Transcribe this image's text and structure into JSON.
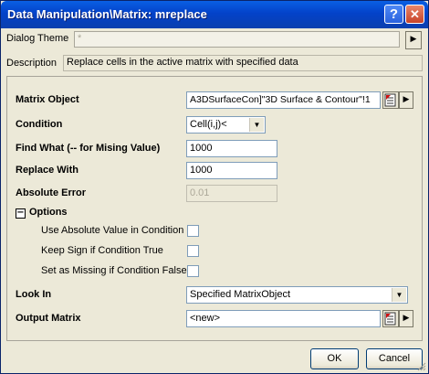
{
  "title": "Data Manipulation\\Matrix: mreplace",
  "titlebar_buttons": {
    "help": "?",
    "close": "✕"
  },
  "theme": {
    "label": "Dialog Theme",
    "value": "*",
    "arrow": "▶"
  },
  "description": {
    "label": "Description",
    "value": "Replace cells in the active matrix with specified data"
  },
  "form": {
    "matrix_object": {
      "label": "Matrix Object",
      "value": "A3DSurfaceCon]\"3D Surface & Contour\"!1"
    },
    "condition": {
      "label": "Condition",
      "value": "Cell(i,j)<"
    },
    "find_what": {
      "label": "Find What (-- for Mising Value)",
      "value": "1000"
    },
    "replace_with": {
      "label": "Replace With",
      "value": "1000"
    },
    "absolute_error": {
      "label": "Absolute Error",
      "value": "0.01"
    },
    "options": {
      "label": "Options",
      "use_absolute": "Use Absolute Value in Condition",
      "keep_sign": "Keep Sign if Condition True",
      "set_missing": "Set as Missing if Condition False"
    },
    "look_in": {
      "label": "Look In",
      "value": "Specified MatrixObject"
    },
    "output_matrix": {
      "label": "Output Matrix",
      "value": "<new>"
    }
  },
  "buttons": {
    "ok": "OK",
    "cancel": "Cancel"
  },
  "glyphs": {
    "dropdown": "▼",
    "arrow_right": "▶",
    "minus": "−"
  },
  "colors": {
    "titlebar": "#0342c9",
    "dialog_bg": "#ece9d8",
    "field_border": "#7f9db9"
  }
}
